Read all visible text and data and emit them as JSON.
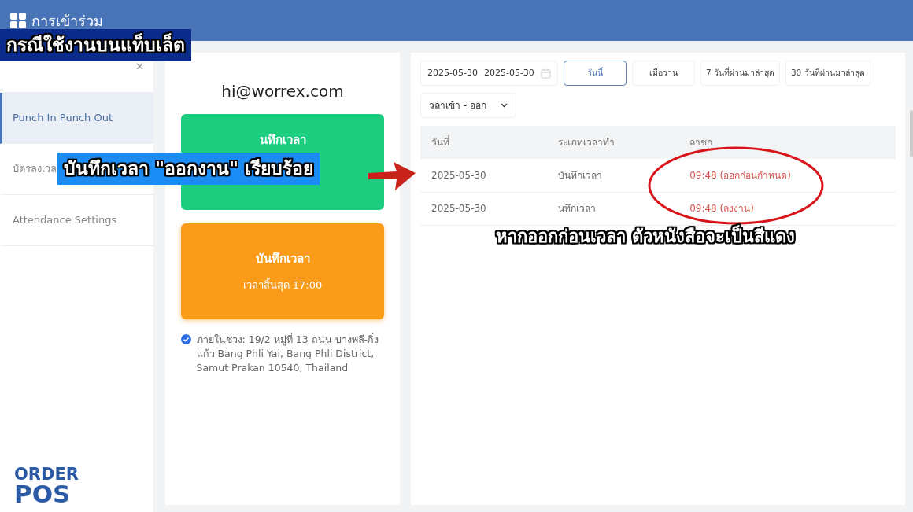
{
  "header": {
    "title": "การเข้าร่วม"
  },
  "sidebar": {
    "items": [
      {
        "label": "Punch In Punch Out",
        "selected": true
      },
      {
        "label": "บัตรลงเวล",
        "selected": false
      },
      {
        "label": "Attendance Settings",
        "selected": false
      }
    ]
  },
  "punch": {
    "email": "hi@worrex.com",
    "cards": [
      {
        "kind": "in",
        "title": "นทึกเวลา"
      },
      {
        "kind": "out",
        "title": "บันทึกเวลา",
        "subtitle": "เวลาสิ้นสุด 17:00"
      }
    ],
    "location": {
      "checked": true,
      "text": "ภายในช่วง: 19/2 หมู่ที่ 13 ถนน บางพลี-กิ่งแก้ว Bang Phli Yai, Bang Phli District, Samut Prakan 10540, Thailand"
    }
  },
  "filters": {
    "date_from": "2025-05-30",
    "date_to": "2025-05-30",
    "ranges": [
      {
        "label": "วันนี้",
        "selected": true
      },
      {
        "label": "เมื่อวาน",
        "selected": false
      },
      {
        "label": "7 วันที่ผ่านมาล่าสุด",
        "selected": false
      },
      {
        "label": "30 วันที่ผ่านมาล่าสุด",
        "selected": false
      }
    ],
    "type_select": "วลาเข้า - ออก"
  },
  "table": {
    "columns": [
      "วันที่",
      "ระเภทเวลาทำ",
      "ลาชก"
    ],
    "rows": [
      {
        "date": "2025-05-30",
        "type": "บันทึกเวลา",
        "time": "09:48 (ออกก่อนกำหนด)",
        "alert": true
      },
      {
        "date": "2025-05-30",
        "type": "นทึกเวลา",
        "time": "09:48 (ลงงาน)",
        "alert": true
      }
    ]
  },
  "captions": [
    {
      "kind": "title",
      "text": "กรณีใช้งานบนแท็บเล็ต"
    },
    {
      "kind": "note",
      "text": "บันทึกเวลา \"ออกงาน\" เรียบร้อย"
    },
    {
      "kind": "plain",
      "text": "หากออกก่อนเวลา ตัวหนังสือจะเป็น**สีแดง**"
    }
  ],
  "logo": {
    "top": "ORDER",
    "bottom": "POS"
  }
}
